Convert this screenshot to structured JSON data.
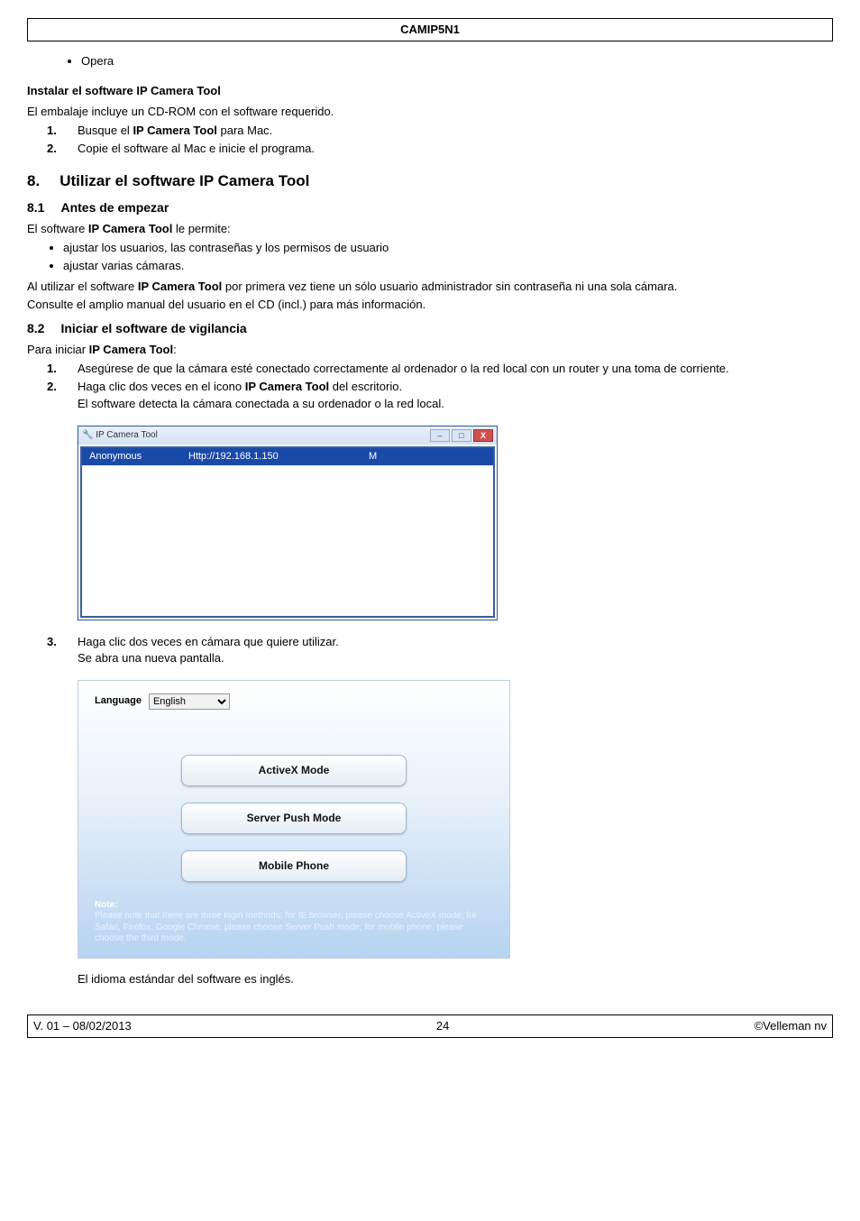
{
  "header": {
    "title": "CAMIP5N1"
  },
  "opera_item": "Opera",
  "sec_install": {
    "heading": "Instalar el software IP Camera Tool",
    "intro": "El embalaje incluye un CD-ROM con el software requerido.",
    "steps": [
      {
        "num": "1.",
        "pre": "Busque el ",
        "bold": "IP Camera Tool",
        "post": " para Mac."
      },
      {
        "num": "2.",
        "pre": "Copie el software al Mac e inicie el programa.",
        "bold": "",
        "post": ""
      }
    ]
  },
  "sec8": {
    "num": "8.",
    "title": "Utilizar el software IP Camera Tool"
  },
  "sec81": {
    "num": "8.1",
    "title": "Antes de empezar",
    "line1_pre": "El software ",
    "line1_bold": "IP Camera Tool",
    "line1_post": " le permite:",
    "bullets": [
      "ajustar los usuarios, las contraseñas y los permisos de usuario",
      "ajustar varias cámaras."
    ],
    "p2_pre": "Al utilizar el software ",
    "p2_bold": "IP Camera Tool",
    "p2_post": " por primera vez tiene un sólo usuario administrador sin contraseña ni una sola cámara.",
    "p3": "Consulte el amplio manual del usuario en el CD (incl.) para más información."
  },
  "sec82": {
    "num": "8.2",
    "title": "Iniciar el software de vigilancia",
    "line1_pre": "Para iniciar ",
    "line1_bold": "IP Camera Tool",
    "line1_post": ":",
    "step1": {
      "num": "1.",
      "text": "Asegúrese de que la cámara esté conectado correctamente al ordenador o la red local con un router y una toma de corriente."
    },
    "step2": {
      "num": "2.",
      "pre": "Haga clic dos veces en el icono ",
      "bold": "IP Camera Tool",
      "post": " del escritorio.",
      "line2": "El software detecta la cámara conectada a su ordenador o la red local."
    },
    "step3": {
      "num": "3.",
      "text": "Haga clic dos veces en cámara que quiere utilizar.",
      "line2": "Se abra una nueva pantalla."
    },
    "after_panel": "El idioma estándar del software es inglés."
  },
  "win1": {
    "title": "IP Camera Tool",
    "close": "X",
    "row": {
      "name": "Anonymous",
      "url": "Http://192.168.1.150",
      "flag": "M"
    }
  },
  "panel": {
    "lang_label": "Language",
    "lang_value": "English",
    "btn1": "ActiveX Mode",
    "btn2": "Server Push Mode",
    "btn3": "Mobile Phone",
    "note_label": "Note:",
    "note_text": "Please note that there are three login methods: for IE browser, please choose ActiveX mode; for Safari, Firefox, Google Chrome, please choose Server Push mode; for mobile phone, please choose the third mode."
  },
  "footer": {
    "left": "V. 01 – 08/02/2013",
    "center": "24",
    "right": "©Velleman nv"
  }
}
